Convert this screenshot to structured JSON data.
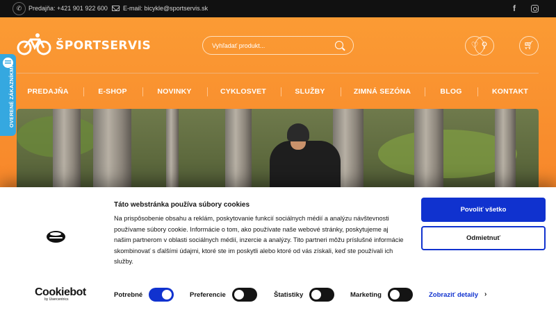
{
  "topbar": {
    "phone": "Predajňa: +421 901 922 600",
    "email": "E-mail: bicykle@sportservis.sk",
    "icons": [
      "phone-icon",
      "mail-icon",
      "facebook-icon",
      "instagram-icon"
    ]
  },
  "header": {
    "logo_text": "ŠPORTSERVIS",
    "search_placeholder": "Vyhľadať produkt...",
    "icons": [
      "wishlist-icon",
      "user-icon",
      "cart-icon"
    ]
  },
  "nav": [
    "PREDAJŇA",
    "E-SHOP",
    "NOVINKY",
    "CYKLOSVET",
    "SLUŽBY",
    "ZIMNÁ SEZÓNA",
    "BLOG",
    "KONTAKT"
  ],
  "side_tab": {
    "label": "OVERENÉ ZÁKAZNÍKMI"
  },
  "cookie": {
    "title": "Táto webstránka používa súbory cookies",
    "text": "Na prispôsobenie obsahu a reklám, poskytovanie funkcií sociálnych médií a analýzu návštevnosti používame súbory cookie. Informácie o tom, ako používate naše webové stránky, poskytujeme aj našim partnerom v oblasti sociálnych médií, inzercie a analýzy. Tito partneri môžu príslušné informácie skombinovať s ďalšími údajmi, ktoré ste im poskytli alebo ktoré od vás získali, keď ste používali ich služby.",
    "allow_all": "Povoliť všetko",
    "deny": "Odmietnuť",
    "brand": "Cookiebot",
    "brand_sub": "by Usercentrics",
    "toggles": [
      {
        "label": "Potrebné",
        "on": true
      },
      {
        "label": "Preferencie",
        "on": false
      },
      {
        "label": "Štatistiky",
        "on": false
      },
      {
        "label": "Marketing",
        "on": false
      }
    ],
    "details": "Zobraziť detaily",
    "details_arrow": "›"
  },
  "colors": {
    "accent_orange": "#f7862a",
    "cookie_blue": "#1032cf",
    "side_tab": "#35a8e0"
  }
}
